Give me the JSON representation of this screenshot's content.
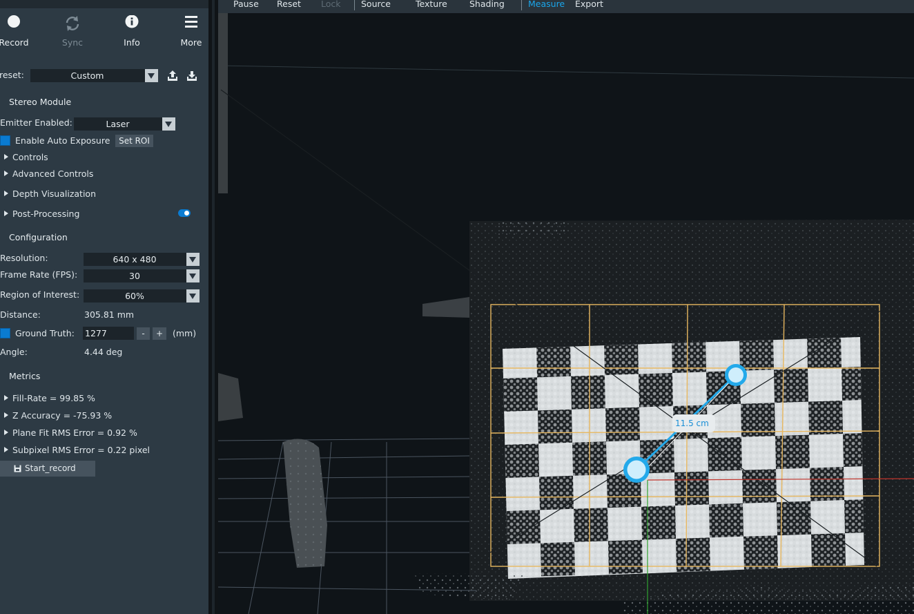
{
  "toolbar": {
    "record": "Record",
    "sync": "Sync",
    "info": "Info",
    "more": "More"
  },
  "preset": {
    "label": "reset:",
    "value": "Custom"
  },
  "stereo_module": {
    "title": "Stereo Module",
    "emitter_label": "Emitter Enabled:",
    "emitter_value": "Laser",
    "auto_exposure_label": "Enable Auto Exposure",
    "set_roi": "Set ROI",
    "controls": "Controls",
    "advanced_controls": "Advanced Controls",
    "depth_visualization": "Depth Visualization",
    "post_processing": "Post-Processing"
  },
  "configuration": {
    "title": "Configuration",
    "resolution_label": "Resolution:",
    "resolution_value": "640 x 480",
    "fps_label": "Frame Rate (FPS):",
    "fps_value": "30",
    "roi_label": "Region of Interest:",
    "roi_value": "60%",
    "distance_label": "Distance:",
    "distance_value": "305.81 mm",
    "ground_truth_label": "Ground Truth:",
    "ground_truth_value": "1277",
    "minus": "-",
    "plus": "+",
    "unit": "(mm)",
    "angle_label": "Angle:",
    "angle_value": "4.44 deg"
  },
  "metrics": {
    "title": "Metrics",
    "items": [
      "Fill-Rate = 99.85 %",
      "Z Accuracy = -75.93 %",
      "Plane Fit RMS Error = 0.92 %",
      "Subpixel RMS Error = 0.22 pixel"
    ],
    "start_record": "Start_record"
  },
  "menu": {
    "pause": "Pause",
    "reset": "Reset",
    "lock": "Lock",
    "source": "Source",
    "texture": "Texture",
    "shading": "Shading",
    "measure": "Measure",
    "export": "Export"
  },
  "measurement": {
    "label": "11.5 cm"
  },
  "colors": {
    "accent": "#1aa5ea",
    "panel": "#2d3a44",
    "roi_box": "#e8b860"
  },
  "icons": [
    "record-icon",
    "sync-icon",
    "info-icon",
    "hamburger-icon",
    "upload-icon",
    "download-icon",
    "save-icon"
  ]
}
